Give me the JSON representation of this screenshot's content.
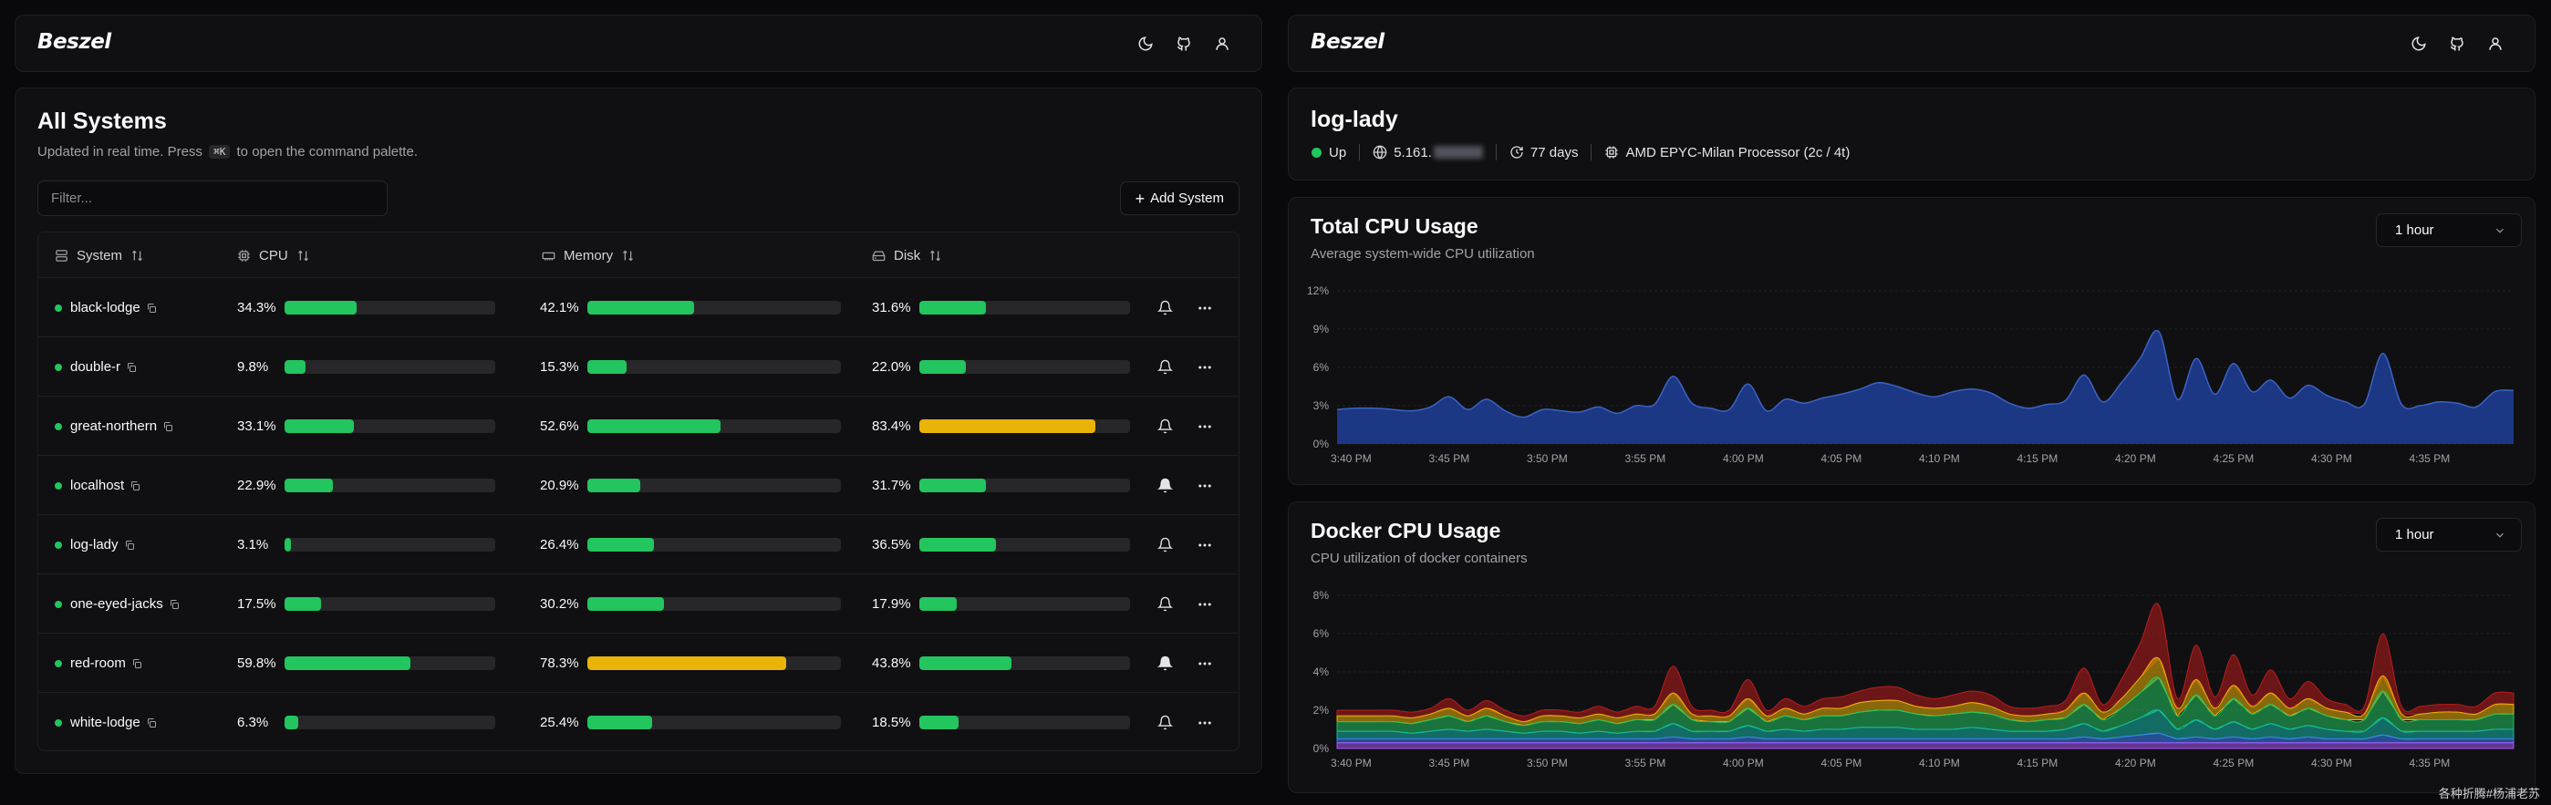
{
  "left": {
    "header": {
      "logo": "Beszel"
    },
    "title": "All Systems",
    "subtitle_before": "Updated in real time. Press",
    "subtitle_kbd": "⌘K",
    "subtitle_after": "to open the command palette.",
    "filter_placeholder": "Filter...",
    "add_system_label": "Add System",
    "columns": {
      "system": "System",
      "cpu": "CPU",
      "memory": "Memory",
      "disk": "Disk"
    },
    "rows": [
      {
        "name": "black-lodge",
        "status": "up",
        "cpu": "34.3%",
        "cpu_value": 34.3,
        "memory": "42.1%",
        "memory_value": 42.1,
        "disk": "31.6%",
        "disk_value": 31.6,
        "alerts": false
      },
      {
        "name": "double-r",
        "status": "up",
        "cpu": "9.8%",
        "cpu_value": 9.8,
        "memory": "15.3%",
        "memory_value": 15.3,
        "disk": "22.0%",
        "disk_value": 22.0,
        "alerts": false
      },
      {
        "name": "great-northern",
        "status": "up",
        "cpu": "33.1%",
        "cpu_value": 33.1,
        "memory": "52.6%",
        "memory_value": 52.6,
        "disk": "83.4%",
        "disk_value": 83.4,
        "alerts": false
      },
      {
        "name": "localhost",
        "status": "up",
        "cpu": "22.9%",
        "cpu_value": 22.9,
        "memory": "20.9%",
        "memory_value": 20.9,
        "disk": "31.7%",
        "disk_value": 31.7,
        "alerts": true
      },
      {
        "name": "log-lady",
        "status": "up",
        "cpu": "3.1%",
        "cpu_value": 3.1,
        "memory": "26.4%",
        "memory_value": 26.4,
        "disk": "36.5%",
        "disk_value": 36.5,
        "alerts": false
      },
      {
        "name": "one-eyed-jacks",
        "status": "up",
        "cpu": "17.5%",
        "cpu_value": 17.5,
        "memory": "30.2%",
        "memory_value": 30.2,
        "disk": "17.9%",
        "disk_value": 17.9,
        "alerts": false
      },
      {
        "name": "red-room",
        "status": "up",
        "cpu": "59.8%",
        "cpu_value": 59.8,
        "memory": "78.3%",
        "memory_value": 78.3,
        "disk": "43.8%",
        "disk_value": 43.8,
        "alerts": true
      },
      {
        "name": "white-lodge",
        "status": "up",
        "cpu": "6.3%",
        "cpu_value": 6.3,
        "memory": "25.4%",
        "memory_value": 25.4,
        "disk": "18.5%",
        "disk_value": 18.5,
        "alerts": false
      }
    ]
  },
  "right": {
    "header": {
      "logo": "Beszel"
    },
    "system_name": "log-lady",
    "status": "Up",
    "ip_prefix": "5.161.",
    "uptime": "77 days",
    "cpu_model": "AMD EPYC-Milan Processor (2c / 4t)",
    "colors": {
      "up": "#22c55e",
      "bar_ok": "#22c55e",
      "bar_warn": "#eab308",
      "cpu_area": "#1e3a8a"
    }
  },
  "chart_data": [
    {
      "type": "area",
      "title": "Total CPU Usage",
      "subtitle": "Average system-wide CPU utilization",
      "range_label": "1 hour",
      "y_ticks": [
        "0%",
        "3%",
        "6%",
        "9%",
        "12%"
      ],
      "ylim": [
        0,
        12
      ],
      "x_ticks": [
        "3:40 PM",
        "3:45 PM",
        "3:50 PM",
        "3:55 PM",
        "4:00 PM",
        "4:05 PM",
        "4:10 PM",
        "4:15 PM",
        "4:20 PM",
        "4:25 PM",
        "4:30 PM",
        "4:35 PM"
      ],
      "series": [
        {
          "values": [
            2.7,
            2.8,
            2.8,
            2.7,
            2.6,
            2.9,
            3.7,
            2.7,
            3.5,
            2.6,
            2.1,
            2.7,
            2.6,
            2.5,
            2.9,
            2.4,
            3.0,
            3.1,
            5.3,
            3.2,
            2.8,
            2.7,
            4.7,
            2.6,
            3.5,
            3.2,
            3.6,
            3.9,
            4.3,
            4.8,
            4.5,
            4.0,
            3.7,
            4.1,
            4.3,
            4.0,
            3.2,
            2.8,
            3.1,
            3.4,
            5.4,
            3.3,
            4.8,
            6.7,
            8.8,
            3.5,
            6.7,
            3.9,
            6.3,
            4.1,
            5.0,
            3.6,
            4.6,
            3.8,
            3.3,
            3.1,
            7.1,
            3.1,
            3.0,
            3.3,
            3.2,
            2.9,
            4.1,
            4.2
          ]
        }
      ]
    },
    {
      "type": "area",
      "title": "Docker CPU Usage",
      "subtitle": "CPU utilization of docker containers",
      "range_label": "1 hour",
      "y_ticks": [
        "0%",
        "2%",
        "4%",
        "6%",
        "8%"
      ],
      "ylim": [
        0,
        8
      ],
      "x_ticks": [
        "3:40 PM",
        "3:45 PM",
        "3:50 PM",
        "3:55 PM",
        "4:00 PM",
        "4:05 PM",
        "4:10 PM",
        "4:15 PM",
        "4:20 PM",
        "4:25 PM",
        "4:30 PM",
        "4:35 PM"
      ],
      "series": [
        {
          "color": "#a855f7",
          "values": [
            0.3,
            0.3,
            0.3,
            0.3,
            0.3,
            0.3,
            0.3,
            0.3,
            0.3,
            0.3,
            0.3,
            0.3,
            0.3,
            0.3,
            0.3,
            0.3,
            0.3,
            0.3,
            0.3,
            0.3,
            0.3,
            0.3,
            0.3,
            0.3,
            0.3,
            0.3,
            0.3,
            0.3,
            0.3,
            0.3,
            0.3,
            0.3,
            0.3,
            0.3,
            0.3,
            0.3,
            0.3,
            0.3,
            0.3,
            0.3,
            0.3,
            0.3,
            0.3,
            0.3,
            0.3,
            0.3,
            0.3,
            0.3,
            0.3,
            0.3,
            0.3,
            0.3,
            0.3,
            0.3,
            0.3,
            0.3,
            0.3,
            0.3,
            0.3,
            0.3,
            0.3,
            0.3,
            0.3,
            0.3
          ]
        },
        {
          "color": "#3b82f6",
          "values": [
            0.2,
            0.2,
            0.2,
            0.2,
            0.2,
            0.2,
            0.2,
            0.2,
            0.2,
            0.2,
            0.2,
            0.2,
            0.2,
            0.2,
            0.2,
            0.2,
            0.2,
            0.2,
            0.3,
            0.2,
            0.2,
            0.2,
            0.3,
            0.2,
            0.2,
            0.2,
            0.2,
            0.2,
            0.2,
            0.2,
            0.2,
            0.2,
            0.2,
            0.2,
            0.2,
            0.2,
            0.2,
            0.2,
            0.2,
            0.2,
            0.3,
            0.2,
            0.3,
            0.4,
            0.5,
            0.2,
            0.3,
            0.2,
            0.3,
            0.2,
            0.3,
            0.2,
            0.3,
            0.2,
            0.2,
            0.2,
            0.4,
            0.2,
            0.2,
            0.2,
            0.2,
            0.2,
            0.2,
            0.2
          ]
        },
        {
          "color": "#14b8a6",
          "values": [
            0.4,
            0.4,
            0.4,
            0.4,
            0.3,
            0.4,
            0.5,
            0.4,
            0.5,
            0.4,
            0.3,
            0.4,
            0.4,
            0.3,
            0.4,
            0.3,
            0.4,
            0.4,
            0.7,
            0.4,
            0.4,
            0.4,
            0.6,
            0.4,
            0.5,
            0.4,
            0.5,
            0.5,
            0.6,
            0.6,
            0.6,
            0.5,
            0.5,
            0.5,
            0.6,
            0.5,
            0.4,
            0.4,
            0.4,
            0.5,
            0.7,
            0.4,
            0.6,
            0.9,
            1.2,
            0.5,
            0.9,
            0.5,
            0.8,
            0.5,
            0.7,
            0.5,
            0.6,
            0.5,
            0.4,
            0.4,
            0.9,
            0.4,
            0.4,
            0.4,
            0.4,
            0.4,
            0.5,
            0.5
          ]
        },
        {
          "color": "#22c55e",
          "values": [
            0.5,
            0.5,
            0.5,
            0.5,
            0.5,
            0.6,
            0.7,
            0.5,
            0.7,
            0.5,
            0.4,
            0.5,
            0.5,
            0.5,
            0.6,
            0.5,
            0.6,
            0.6,
            1.0,
            0.6,
            0.5,
            0.5,
            0.9,
            0.5,
            0.7,
            0.6,
            0.7,
            0.7,
            0.8,
            0.9,
            0.9,
            0.8,
            0.7,
            0.8,
            0.8,
            0.8,
            0.6,
            0.5,
            0.6,
            0.6,
            1.0,
            0.6,
            0.9,
            1.3,
            1.7,
            0.7,
            1.3,
            0.7,
            1.2,
            0.8,
            1.0,
            0.7,
            0.9,
            0.7,
            0.6,
            0.6,
            1.4,
            0.6,
            0.6,
            0.6,
            0.6,
            0.6,
            0.8,
            0.8
          ]
        },
        {
          "color": "#eab308",
          "values": [
            0.3,
            0.3,
            0.3,
            0.3,
            0.3,
            0.3,
            0.4,
            0.3,
            0.4,
            0.3,
            0.2,
            0.3,
            0.3,
            0.3,
            0.3,
            0.3,
            0.3,
            0.3,
            0.6,
            0.3,
            0.3,
            0.3,
            0.5,
            0.3,
            0.4,
            0.3,
            0.4,
            0.4,
            0.5,
            0.5,
            0.5,
            0.4,
            0.4,
            0.4,
            0.5,
            0.4,
            0.3,
            0.3,
            0.3,
            0.4,
            0.6,
            0.4,
            0.5,
            0.8,
            1.0,
            0.4,
            0.8,
            0.4,
            0.7,
            0.4,
            0.6,
            0.4,
            0.5,
            0.4,
            0.4,
            0.3,
            0.8,
            0.3,
            0.3,
            0.4,
            0.4,
            0.3,
            0.5,
            0.5
          ]
        },
        {
          "color": "#b91c1c",
          "values": [
            0.3,
            0.3,
            0.3,
            0.3,
            0.3,
            0.3,
            0.5,
            0.3,
            0.4,
            0.3,
            0.3,
            0.3,
            0.3,
            0.3,
            0.4,
            0.3,
            0.4,
            0.4,
            1.4,
            0.4,
            0.3,
            0.3,
            1.0,
            0.3,
            0.5,
            0.4,
            0.5,
            0.6,
            0.6,
            0.7,
            0.7,
            0.6,
            0.5,
            0.6,
            0.6,
            0.6,
            0.4,
            0.4,
            0.4,
            0.5,
            1.3,
            0.4,
            1.0,
            1.8,
            2.8,
            0.5,
            1.8,
            0.6,
            1.6,
            0.6,
            1.2,
            0.5,
            0.9,
            0.5,
            0.4,
            0.4,
            2.2,
            0.4,
            0.4,
            0.4,
            0.4,
            0.4,
            0.6,
            0.6
          ]
        }
      ]
    }
  ],
  "watermark": "各种折腾#杨浦老苏"
}
